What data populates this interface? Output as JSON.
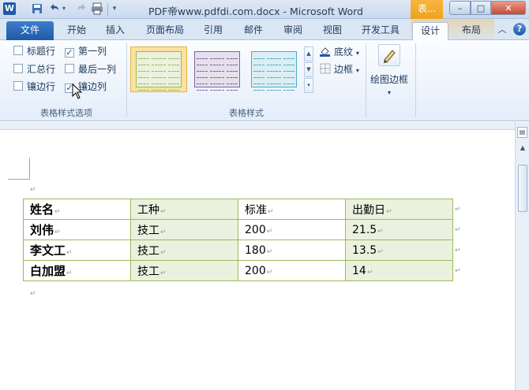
{
  "titlebar": {
    "app_icon_letter": "W",
    "title": "PDF帝www.pdfdi.com.docx - Microsoft Word",
    "context_tab_group": "表...",
    "minimize_label": "–",
    "maximize_label": "□",
    "close_label": "✕"
  },
  "tabs": {
    "file": "文件",
    "home": "开始",
    "insert": "插入",
    "page_layout": "页面布局",
    "references": "引用",
    "mailings": "邮件",
    "review": "审阅",
    "view": "视图",
    "developer": "开发工具",
    "design": "设计",
    "layout": "布局",
    "active": "设计"
  },
  "style_options": {
    "header_row": {
      "label": "标题行",
      "checked": false
    },
    "first_column": {
      "label": "第一列",
      "checked": true
    },
    "total_row": {
      "label": "汇总行",
      "checked": false
    },
    "last_column": {
      "label": "最后一列",
      "checked": false
    },
    "banded_rows": {
      "label": "镶边行",
      "checked": false
    },
    "banded_columns": {
      "label": "镶边列",
      "checked": true
    },
    "group_label": "表格样式选项"
  },
  "table_styles": {
    "group_label": "表格样式",
    "thumbs": [
      {
        "name": "green",
        "color": "#9bbb59",
        "fill": "#ebf1de",
        "selected": true
      },
      {
        "name": "purple",
        "color": "#8064a2",
        "fill": "#e5e0ec",
        "selected": false
      },
      {
        "name": "aqua",
        "color": "#4bacc6",
        "fill": "#dbeef3",
        "selected": false
      }
    ],
    "shading_label": "底纹",
    "borders_label": "边框"
  },
  "draw_borders": {
    "label": "绘图边框"
  },
  "document": {
    "table": {
      "rows": [
        [
          "姓名",
          "工种",
          "标准",
          "出勤日"
        ],
        [
          "刘伟",
          "技工",
          "200",
          "21.5"
        ],
        [
          "李文工",
          "技工",
          "180",
          "13.5"
        ],
        [
          "白加盟",
          "技工",
          "200",
          "14"
        ]
      ]
    },
    "paragraph_mark": "↵"
  },
  "colors": {
    "band_fill": "#ebf1de",
    "table_border": "#9bbb59",
    "file_tab": "#1f5aa6",
    "context_orange": "#f6b640"
  }
}
